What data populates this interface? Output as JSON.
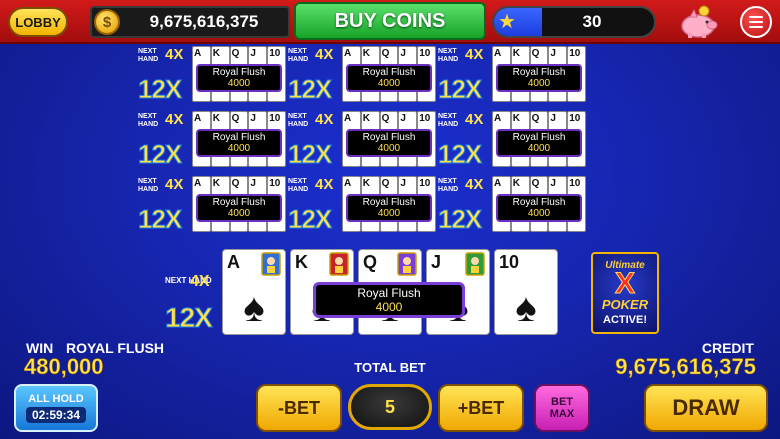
{
  "topbar": {
    "lobby_label": "LOBBY",
    "coin_symbol": "$",
    "coins": "9,675,616,375",
    "buy_coins_label": "BUY COINS",
    "level": "30",
    "level_progress": 0.3
  },
  "hands": [
    {
      "next_label": "NEXT HAND",
      "next_mult": "4X",
      "mult": "12X",
      "cards": [
        "A",
        "K",
        "Q",
        "J",
        "10"
      ],
      "hand_name": "Royal Flush",
      "payout": "4000"
    },
    {
      "next_label": "NEXT HAND",
      "next_mult": "4X",
      "mult": "12X",
      "cards": [
        "A",
        "K",
        "Q",
        "J",
        "10"
      ],
      "hand_name": "Royal Flush",
      "payout": "4000"
    },
    {
      "next_label": "NEXT HAND",
      "next_mult": "4X",
      "mult": "12X",
      "cards": [
        "A",
        "K",
        "Q",
        "J",
        "10"
      ],
      "hand_name": "Royal Flush",
      "payout": "4000"
    },
    {
      "next_label": "NEXT HAND",
      "next_mult": "4X",
      "mult": "12X",
      "cards": [
        "A",
        "K",
        "Q",
        "J",
        "10"
      ],
      "hand_name": "Royal Flush",
      "payout": "4000"
    },
    {
      "next_label": "NEXT HAND",
      "next_mult": "4X",
      "mult": "12X",
      "cards": [
        "A",
        "K",
        "Q",
        "J",
        "10"
      ],
      "hand_name": "Royal Flush",
      "payout": "4000"
    },
    {
      "next_label": "NEXT HAND",
      "next_mult": "4X",
      "mult": "12X",
      "cards": [
        "A",
        "K",
        "Q",
        "J",
        "10"
      ],
      "hand_name": "Royal Flush",
      "payout": "4000"
    },
    {
      "next_label": "NEXT HAND",
      "next_mult": "4X",
      "mult": "12X",
      "cards": [
        "A",
        "K",
        "Q",
        "J",
        "10"
      ],
      "hand_name": "Royal Flush",
      "payout": "4000"
    },
    {
      "next_label": "NEXT HAND",
      "next_mult": "4X",
      "mult": "12X",
      "cards": [
        "A",
        "K",
        "Q",
        "J",
        "10"
      ],
      "hand_name": "Royal Flush",
      "payout": "4000"
    },
    {
      "next_label": "NEXT HAND",
      "next_mult": "4X",
      "mult": "12X",
      "cards": [
        "A",
        "K",
        "Q",
        "J",
        "10"
      ],
      "hand_name": "Royal Flush",
      "payout": "4000"
    }
  ],
  "main_hand": {
    "next_label": "NEXT HAND",
    "next_mult": "4X",
    "mult": "12X",
    "cards": [
      {
        "rank": "A",
        "suit": "♠"
      },
      {
        "rank": "K",
        "suit": "♠"
      },
      {
        "rank": "Q",
        "suit": "♠"
      },
      {
        "rank": "J",
        "suit": "♠"
      },
      {
        "rank": "10",
        "suit": "♠"
      }
    ],
    "hand_name": "Royal Flush",
    "payout": "4000"
  },
  "badge": {
    "line1": "Ultimate",
    "line2": "X",
    "line3": "POKER",
    "line4": "ACTIVE!"
  },
  "win": {
    "label": "WIN",
    "hand": "ROYAL FLUSH",
    "value": "480,000"
  },
  "credit": {
    "label": "CREDIT",
    "value": "9,675,616,375"
  },
  "bet": {
    "total_label": "TOTAL BET",
    "value": "5",
    "minus_label": "-BET",
    "plus_label": "+BET",
    "max_label_1": "BET",
    "max_label_2": "MAX"
  },
  "all_hold": {
    "label": "ALL HOLD",
    "timer": "02:59:34"
  },
  "draw_label": "DRAW",
  "icons": {
    "coin": "coin-icon",
    "star": "star-icon",
    "piggy": "piggy-bank-icon",
    "menu": "hamburger-menu-icon"
  },
  "colors": {
    "topbar": "#c01414",
    "background": "#1726b0",
    "accent_yellow": "#ffe24a",
    "buy_green": "#17a32a",
    "label_border": "#6b2fc2"
  }
}
